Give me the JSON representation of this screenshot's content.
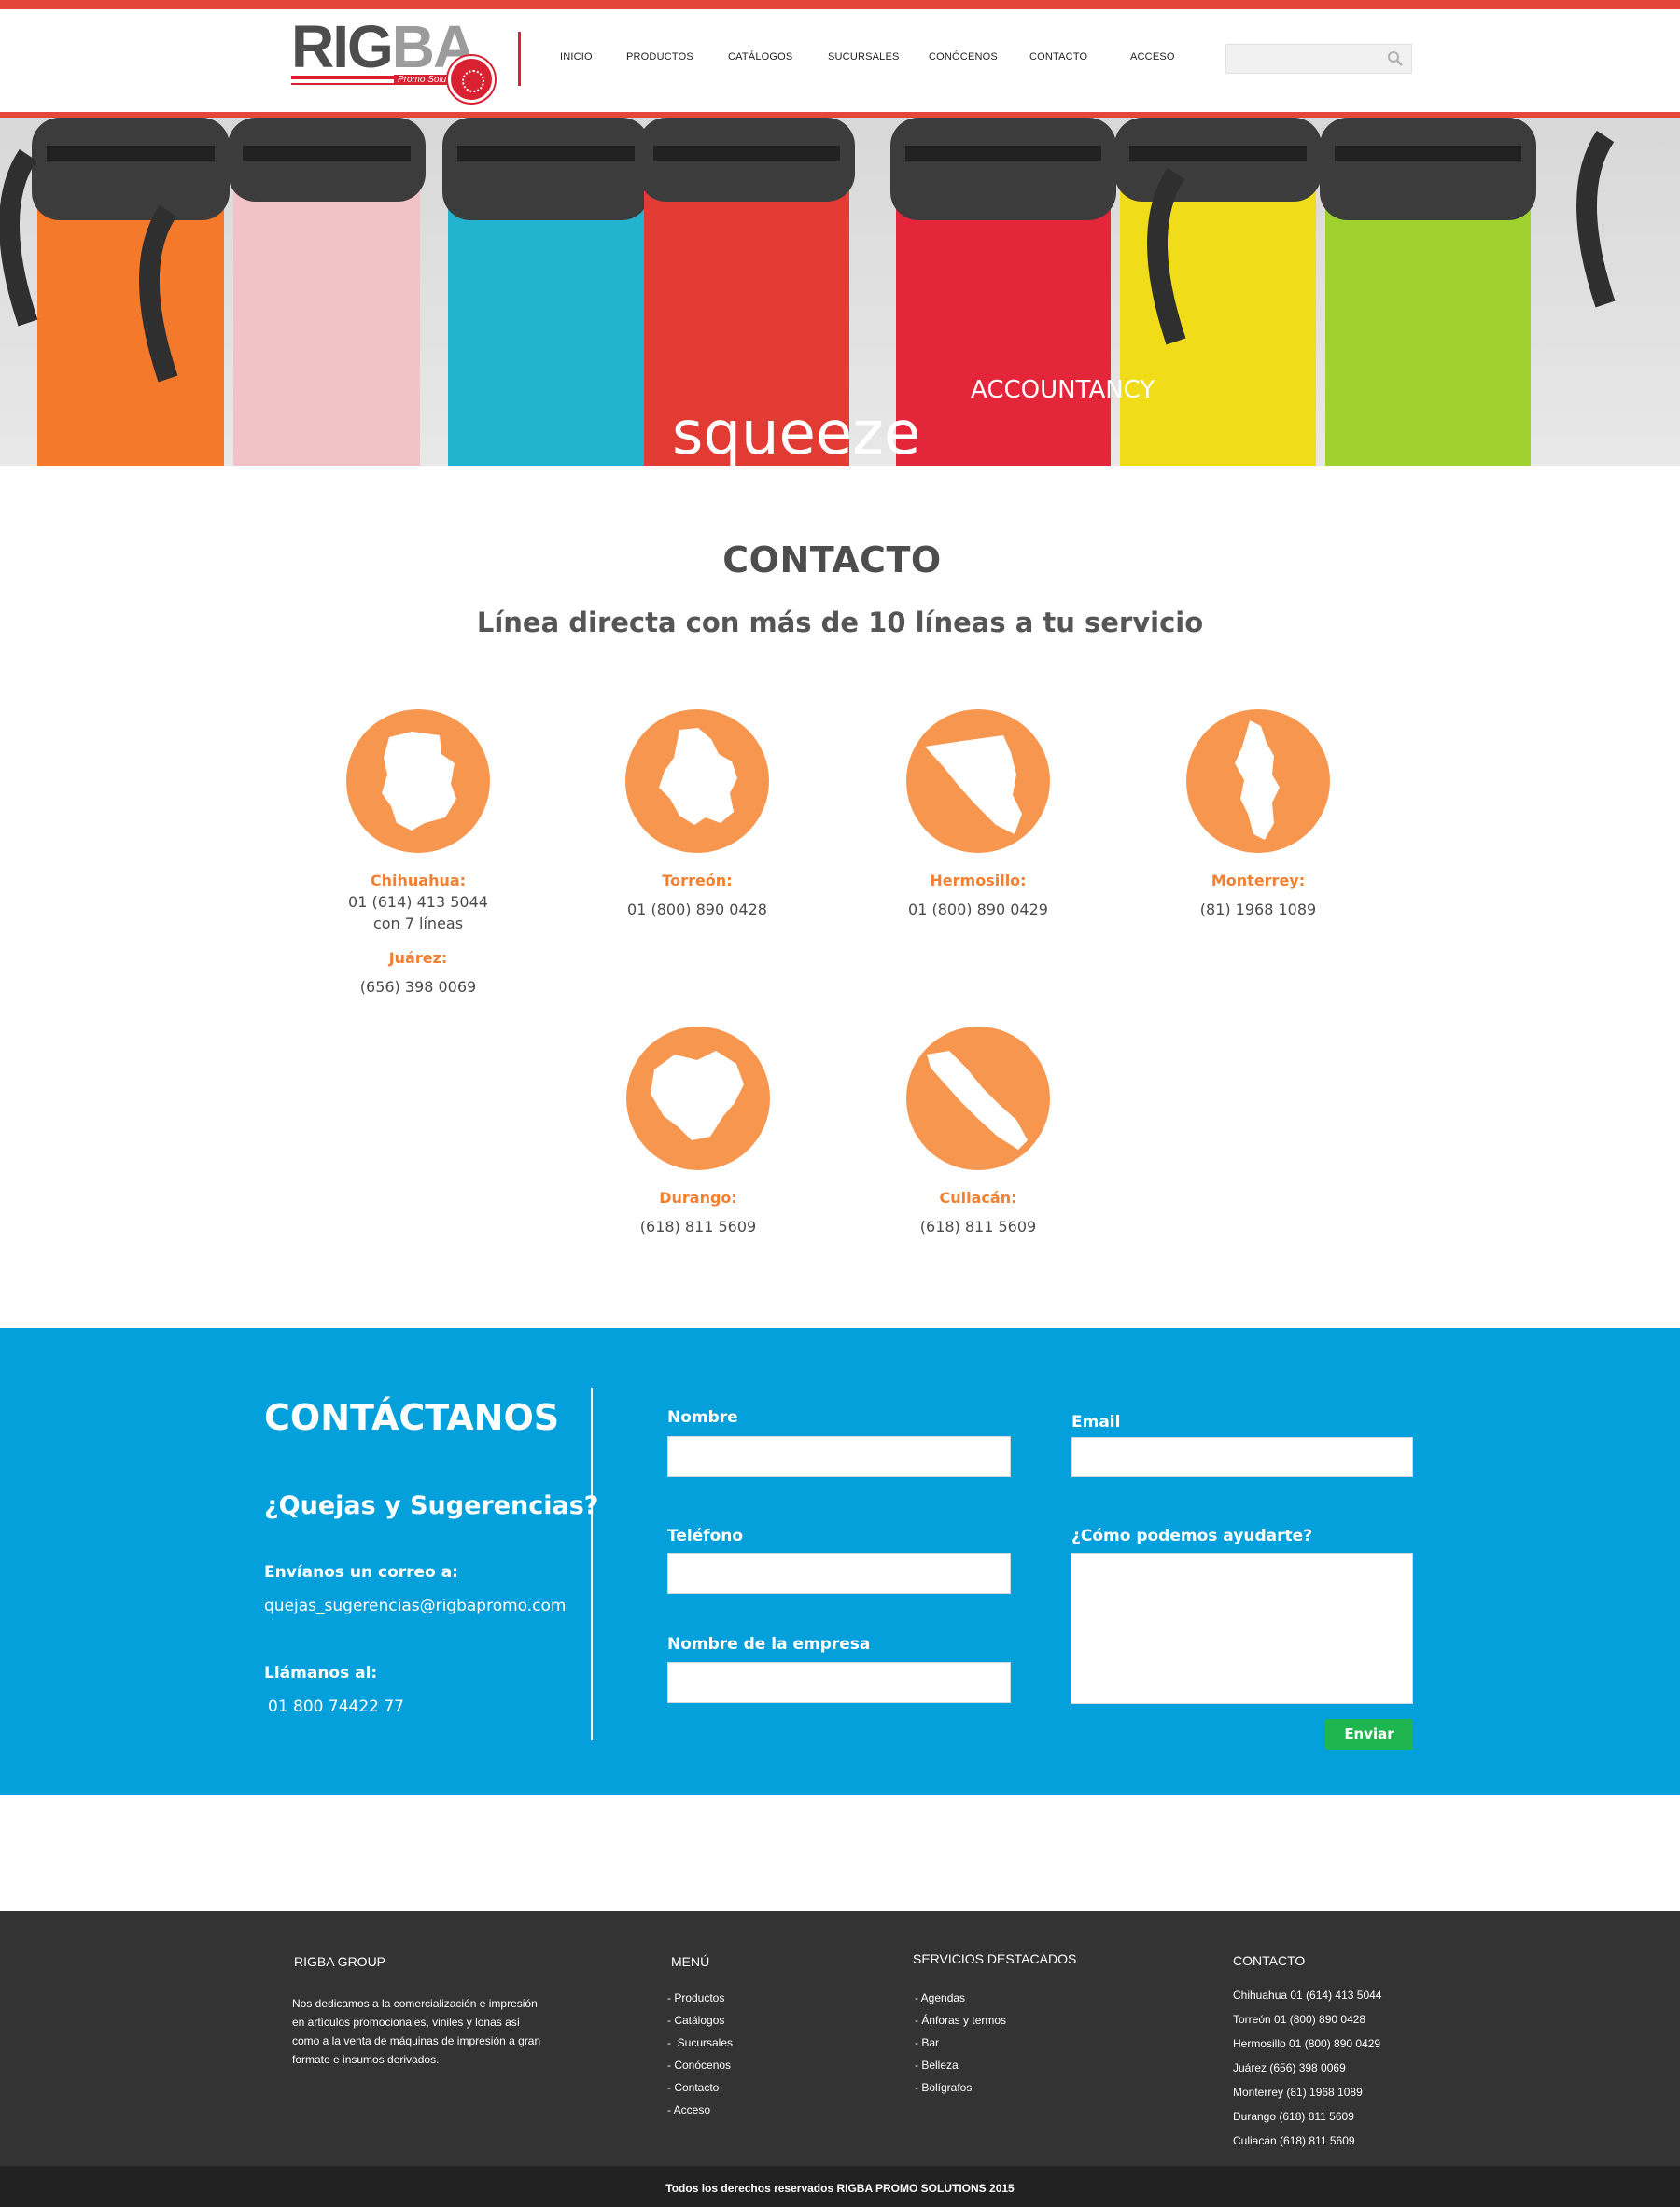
{
  "header": {
    "logo_text_1": "RIG",
    "logo_text_2": "BA",
    "logo_tagline": "Promo Solutions",
    "nav": [
      "INICIO",
      "PRODUCTOS",
      "CATÁLOGOS",
      "SUCURSALES",
      "CONÓCENOS",
      "CONTACTO",
      "ACCESO"
    ],
    "search_placeholder": ""
  },
  "hero": {
    "brand_text": "squeeze",
    "brand_sub": "ACCOUNTANCY",
    "mug_colors": [
      "#f5792a",
      "#f1c3c6",
      "#22b3cf",
      "#e23b33",
      "#e3263a",
      "#f0dc19",
      "#9fd12f"
    ]
  },
  "contact": {
    "title": "CONTACTO",
    "subtitle": "Línea directa con más de 10 líneas a tu servicio",
    "accent": "#f7964f",
    "branches": [
      {
        "name": "Chihuahua:",
        "phone": "01 (614) 413 5044",
        "extra": "con 7 líneas",
        "name2": "Juárez:",
        "phone2": "(656) 398 0069",
        "icon": "chihuahua-map-icon"
      },
      {
        "name": "Torreón:",
        "phone": "01 (800) 890 0428",
        "icon": "coahuila-map-icon"
      },
      {
        "name": "Hermosillo:",
        "phone": "01 (800) 890 0429",
        "icon": "sonora-map-icon"
      },
      {
        "name": "Monterrey:",
        "phone": "(81) 1968 1089",
        "icon": "nuevo-leon-map-icon"
      },
      {
        "name": "Durango:",
        "phone": "(618) 811 5609",
        "icon": "durango-map-icon"
      },
      {
        "name": "Culiacán:",
        "phone": "(618) 811 5609",
        "icon": "sinaloa-map-icon"
      }
    ]
  },
  "form_section": {
    "bg": "#04a0dc",
    "title": "CONTÁCTANOS",
    "subtitle": "¿Quejas y Sugerencias?",
    "email_label": "Envíanos un correo a:",
    "email": "quejas_sugerencias@rigbapromo.com",
    "phone_label": "Llámanos al:",
    "phone": "01 800 74422 77",
    "fields": {
      "nombre": "Nombre",
      "email": "Email",
      "telefono": "Teléfono",
      "ayuda": "¿Cómo podemos ayudarte?",
      "empresa": "Nombre de la empresa"
    },
    "submit": "Enviar",
    "submit_color": "#1fb650"
  },
  "footer": {
    "about_title": "RIGBA GROUP",
    "about_text": [
      "Nos dedicamos a la comercialización e impresión",
      "en artículos promocionales, viniles y lonas así",
      "como a la venta de máquinas de impresión a gran",
      "formato e insumos derivados."
    ],
    "menu_title": "MENÚ",
    "menu_items": [
      "- Productos",
      "- Catálogos",
      "-  Sucursales",
      "- Conócenos",
      "- Contacto",
      "- Acceso"
    ],
    "services_title": "SERVICIOS DESTACADOS",
    "services_items": [
      "- Agendas",
      "- Ánforas y termos",
      "- Bar",
      "- Belleza",
      "- Bolígrafos"
    ],
    "contact_title": "CONTACTO",
    "contact_items": [
      "Chihuahua 01 (614) 413 5044",
      "Torreón 01 (800) 890 0428",
      "Hermosillo 01 (800) 890 0429",
      "Juárez (656) 398 0069",
      "Monterrey (81) 1968 1089",
      "Durango (618) 811 5609",
      "Culiacán (618) 811 5609"
    ],
    "copyright": "Todos los derechos reservados RIGBA PROMO SOLUTIONS 2015"
  }
}
